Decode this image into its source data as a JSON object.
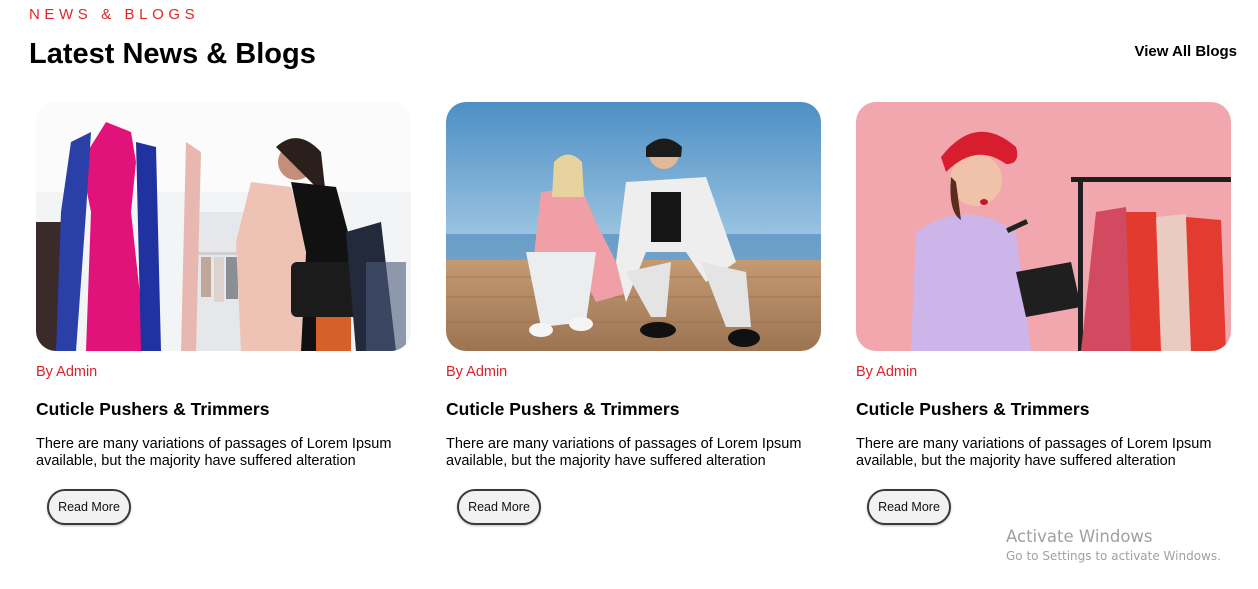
{
  "section": {
    "eyebrow": "NEWS & BLOGS",
    "heading": "Latest News & Blogs",
    "view_all": "View All Blogs"
  },
  "posts": [
    {
      "author": "By Admin",
      "title": "Cuticle Pushers & Trimmers",
      "excerpt": "There are many variations of passages of Lorem Ipsum available, but the majority have suffered alteration",
      "button": "Read More"
    },
    {
      "author": "By Admin",
      "title": "Cuticle Pushers & Trimmers",
      "excerpt": "There are many variations of passages of Lorem Ipsum available, but the majority have suffered alteration",
      "button": "Read More"
    },
    {
      "author": "By Admin",
      "title": "Cuticle Pushers & Trimmers",
      "excerpt": "There are many variations of passages of Lorem Ipsum available, but the majority have suffered alteration",
      "button": "Read More"
    }
  ],
  "watermark": {
    "line1": "Activate Windows",
    "line2": "Go to Settings to activate Windows."
  },
  "colors": {
    "accent": "#e0262a",
    "text": "#000000"
  }
}
